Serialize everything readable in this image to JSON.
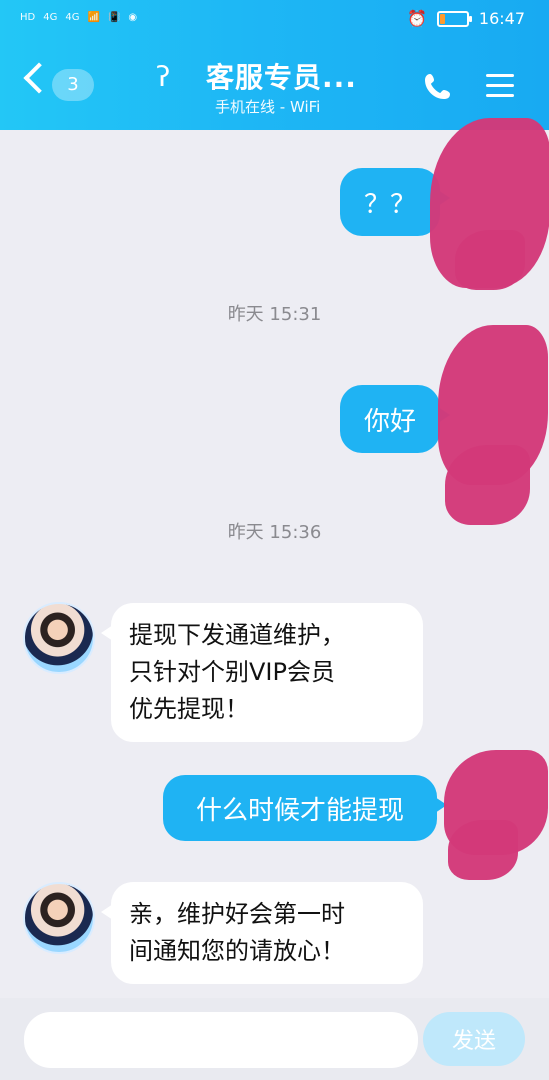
{
  "status_bar": {
    "left_icons": [
      "HD",
      "4G",
      "4G",
      "📶",
      "📳",
      "◉"
    ],
    "time": "16:47"
  },
  "header": {
    "back_badge": "3",
    "title": "客服专员...",
    "subtitle": "手机在线 - WiFi",
    "icons": [
      "back-chevron-icon",
      "ear-icon",
      "phone-icon",
      "menu-icon"
    ]
  },
  "chat": {
    "messages": [
      {
        "type": "outgoing",
        "text": "？？"
      },
      {
        "type": "timestamp",
        "text": "昨天 15:31"
      },
      {
        "type": "outgoing",
        "text": "你好"
      },
      {
        "type": "timestamp",
        "text": "昨天 15:36"
      },
      {
        "type": "incoming",
        "lines": [
          "提现下发通道维护，",
          "只针对个别VIP会员",
          "优先提现！"
        ]
      },
      {
        "type": "outgoing",
        "text": "什么时候才能提现"
      },
      {
        "type": "incoming",
        "lines": [
          "亲，维护好会第一时",
          "间通知您的请放心！"
        ]
      }
    ]
  },
  "input_bar": {
    "placeholder": "",
    "send_label": "发送"
  },
  "colors": {
    "header_start": "#23c7f6",
    "header_end": "#18aaf2",
    "outgoing_bubble": "#1fb3f3",
    "incoming_bubble": "#ffffff",
    "chat_bg": "#ededf3",
    "redaction": "#d33979"
  }
}
